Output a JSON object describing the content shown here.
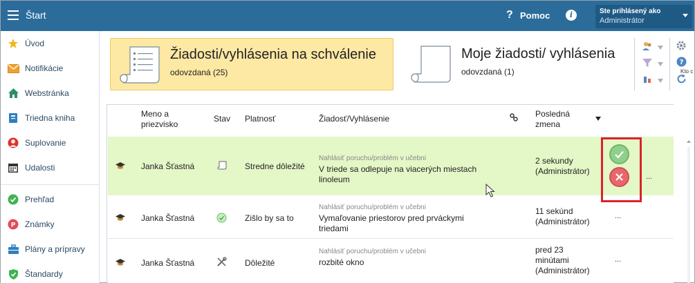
{
  "header": {
    "title": "Štart",
    "help_label": "Pomoc",
    "user_line1": "Ste prihlásený ako",
    "user_line2": "Administrátor"
  },
  "sidebar": {
    "items": [
      {
        "label": "Úvod",
        "icon": "star-icon"
      },
      {
        "label": "Notifikácie",
        "icon": "envelope-icon"
      },
      {
        "label": "Webstránka",
        "icon": "house-icon"
      },
      {
        "label": "Triedna kniha",
        "icon": "book-icon"
      },
      {
        "label": "Suplovanie",
        "icon": "person-icon"
      },
      {
        "label": "Udalosti",
        "icon": "calendar-icon"
      },
      {
        "label": "Prehľad",
        "icon": "check-circle-icon"
      },
      {
        "label": "Známky",
        "icon": "grade-icon"
      },
      {
        "label": "Plány a prípravy",
        "icon": "briefcase-icon"
      },
      {
        "label": "Štandardy",
        "icon": "shield-icon"
      }
    ]
  },
  "cards": [
    {
      "title": "Žiadosti/vyhlásenia na schválenie",
      "subtitle": "odovzdaná (25)"
    },
    {
      "title": "Moje žiadosti/ vyhlásenia",
      "subtitle": "odovzdaná (1)"
    }
  ],
  "tools": {
    "kto_label": "Kto c"
  },
  "table": {
    "headers": {
      "name": "Meno a priezvisko",
      "status": "Stav",
      "validity": "Platnosť",
      "request": "Žiadosť/Vyhlásenie",
      "last_change": "Posledná zmena"
    },
    "rows": [
      {
        "name": "Janka Šťastná",
        "status_icon": "document-icon",
        "validity": "Stredne dôležité",
        "category": "Nahlásiť poruchu/problém v učebni",
        "text": "V triede sa odlepuje na viacerých miestach linoleum",
        "last_change": "2 sekundy (Administrátor)",
        "more": "..."
      },
      {
        "name": "Janka Šťastná",
        "status_icon": "check-circle-icon",
        "validity": "Zišlo by sa to",
        "category": "Nahlásiť poruchu/problém v učebni",
        "text": "Vymaľovanie priestorov pred prváckymi triedami",
        "last_change": "11 sekúnd (Administrátor)",
        "more": "..."
      },
      {
        "name": "Janka Šťastná",
        "status_icon": "tools-icon",
        "validity": "Dôležité",
        "category": "Nahlásiť poruchu/problém v učebni",
        "text": "rozbité okno",
        "last_change": "pred 23 minútami (Administrátor)",
        "more": "..."
      }
    ]
  },
  "colors": {
    "topbar": "#2b6c9b",
    "highlight_card": "#fde8a4",
    "selected_row": "#e4f7c7",
    "approve": "#8fcf8a",
    "reject": "#e8676c",
    "annotation_border": "#d8222b"
  }
}
